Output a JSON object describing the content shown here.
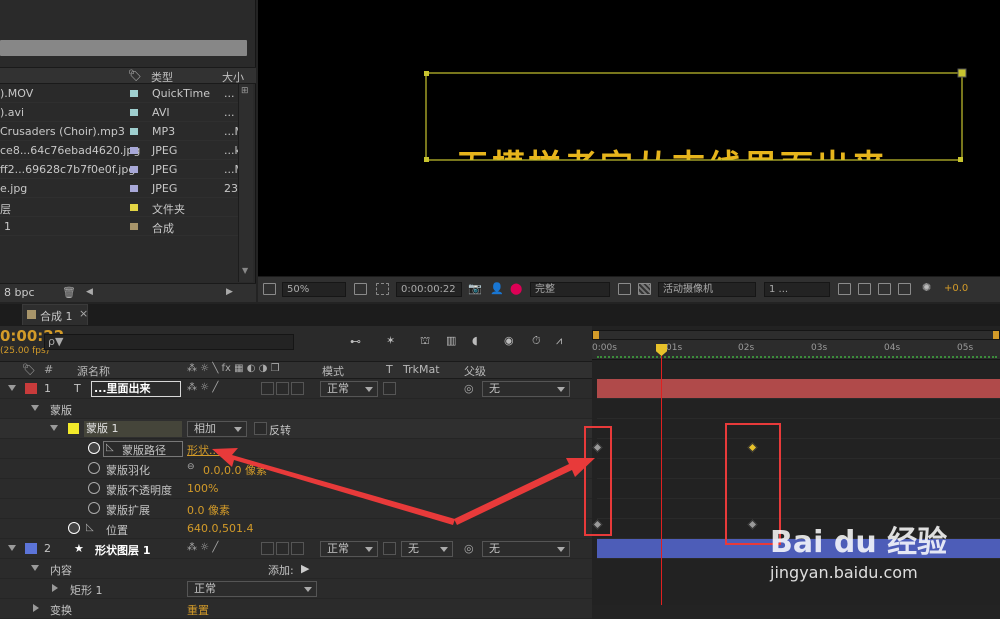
{
  "project": {
    "columns": {
      "type": "类型",
      "size": "大小"
    },
    "items": [
      {
        "name": ").MOV",
        "color": "#9fcfcf",
        "type": "QuickTime",
        "size": "..."
      },
      {
        "name": ").avi",
        "color": "#9fcfcf",
        "type": "AVI",
        "size": "..."
      },
      {
        "name": "Crusaders (Choir).mp3",
        "color": "#9fcfcf",
        "type": "MP3",
        "size": "...M"
      },
      {
        "name": "ce8...64c76ebad4620.jpg",
        "color": "#a8a8d8",
        "type": "JPEG",
        "size": "...k"
      },
      {
        "name": "ff2...69628c7b7f0e0f.jpg",
        "color": "#a8a8d8",
        "type": "JPEG",
        "size": "...M"
      },
      {
        "name": "e.jpg",
        "color": "#a8a8d8",
        "type": "JPEG",
        "size": "23"
      },
      {
        "name": "层",
        "color": "#e3d544",
        "type": "文件夹",
        "size": ""
      },
      {
        "name": "1",
        "color": "#a8956a",
        "type": "合成",
        "size": ""
      }
    ],
    "bpc": "8 bpc"
  },
  "viewer": {
    "text_overlay": "无模样者定从末线里面出来",
    "zoom": "50%",
    "timecode": "0:00:00:22",
    "resolution": "完整",
    "camera": "活动摄像机",
    "views": "1 ...",
    "exposure": "+0.0"
  },
  "timeline": {
    "tab_label": "合成 1",
    "current_time": "0:00:22",
    "fps": "(25.00 fps)",
    "search_placeholder": "ρ▼",
    "headers": {
      "source_name": "源名称",
      "mode": "模式",
      "t": "T",
      "trkmat": "TrkMat",
      "parent": "父级"
    },
    "ruler_labels": [
      "0:00s",
      "01s",
      "02s",
      "03s",
      "04s",
      "05s"
    ],
    "layers": [
      {
        "index": "1",
        "type_icon": "T",
        "name": "...里面出来",
        "color": "#c83b3b",
        "mode": "正常",
        "parent": "无"
      },
      {
        "index": "2",
        "type_icon": "★",
        "name": "形状图层 1",
        "color": "#5c74d8",
        "mode": "正常",
        "trkmat": "无",
        "parent": "无"
      }
    ],
    "masks_group": "蒙版",
    "mask": {
      "name": "蒙版 1",
      "mode": "相加",
      "invert": "反转",
      "color": "#f2ea2a"
    },
    "props": [
      {
        "name": "蒙版路径",
        "value": "形状..."
      },
      {
        "name": "蒙版羽化",
        "value": "0.0,0.0 像素"
      },
      {
        "name": "蒙版不透明度",
        "value": "100%"
      },
      {
        "name": "蒙版扩展",
        "value": "0.0 像素"
      },
      {
        "name": "位置",
        "value": "640.0,501.4"
      }
    ],
    "contents": "内容",
    "add_label": "添加:",
    "rect": "矩形 1",
    "rect_mode": "正常",
    "transform": "变换",
    "transform_value": "重置"
  },
  "watermark": {
    "brand": "Bai du 经验",
    "url": "jingyan.baidu.com"
  },
  "colors": {
    "accent": "#e8c22a",
    "annotation": "#e83a3a",
    "layer1_bar": "#b04a4a",
    "layer2_bar": "#4d5db8"
  }
}
